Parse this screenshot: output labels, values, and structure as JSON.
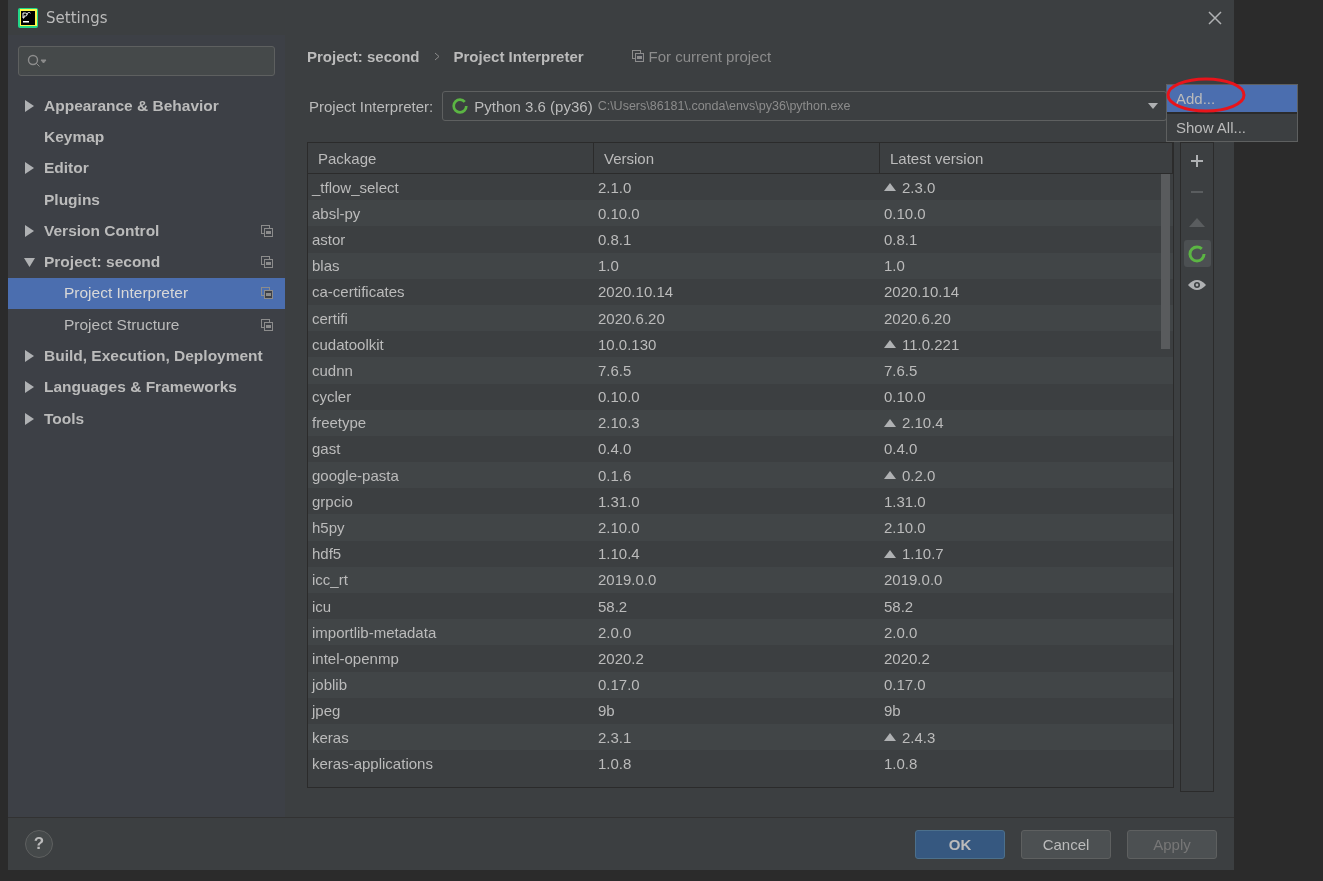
{
  "window": {
    "title": "Settings"
  },
  "sidebar": {
    "items": [
      {
        "label": "Appearance & Behavior",
        "expanded": false,
        "project_icon": false,
        "selected": false
      },
      {
        "label": "Keymap",
        "project_icon": false,
        "selected": false
      },
      {
        "label": "Editor",
        "expanded": false,
        "project_icon": false,
        "selected": false
      },
      {
        "label": "Plugins",
        "project_icon": false,
        "selected": false
      },
      {
        "label": "Version Control",
        "expanded": false,
        "project_icon": true,
        "selected": false
      },
      {
        "label": "Project: second",
        "expanded": true,
        "project_icon": true,
        "selected": false,
        "children": [
          {
            "label": "Project Interpreter",
            "project_icon": true,
            "selected": true
          },
          {
            "label": "Project Structure",
            "project_icon": true,
            "selected": false
          }
        ]
      },
      {
        "label": "Build, Execution, Deployment",
        "expanded": false,
        "project_icon": false,
        "selected": false
      },
      {
        "label": "Languages & Frameworks",
        "expanded": false,
        "project_icon": false,
        "selected": false
      },
      {
        "label": "Tools",
        "expanded": false,
        "project_icon": false,
        "selected": false
      }
    ]
  },
  "breadcrumb": [
    "Project: second",
    "Project Interpreter"
  ],
  "scope_note": "For current project",
  "interpreter": {
    "label": "Project Interpreter:",
    "name": "Python 3.6 (py36)",
    "path": "C:\\Users\\86181\\.conda\\envs\\py36\\python.exe"
  },
  "interpreter_menu": [
    {
      "label": "Add...",
      "selected": true
    },
    {
      "label": "Show All...",
      "selected": false
    }
  ],
  "table": {
    "columns": [
      "Package",
      "Version",
      "Latest version"
    ],
    "rows": [
      {
        "package": "_tflow_select",
        "version": "2.1.0",
        "latest": "2.3.0",
        "upgrade": true
      },
      {
        "package": "absl-py",
        "version": "0.10.0",
        "latest": "0.10.0",
        "upgrade": false
      },
      {
        "package": "astor",
        "version": "0.8.1",
        "latest": "0.8.1",
        "upgrade": false
      },
      {
        "package": "blas",
        "version": "1.0",
        "latest": "1.0",
        "upgrade": false
      },
      {
        "package": "ca-certificates",
        "version": "2020.10.14",
        "latest": "2020.10.14",
        "upgrade": false
      },
      {
        "package": "certifi",
        "version": "2020.6.20",
        "latest": "2020.6.20",
        "upgrade": false
      },
      {
        "package": "cudatoolkit",
        "version": "10.0.130",
        "latest": "11.0.221",
        "upgrade": true
      },
      {
        "package": "cudnn",
        "version": "7.6.5",
        "latest": "7.6.5",
        "upgrade": false
      },
      {
        "package": "cycler",
        "version": "0.10.0",
        "latest": "0.10.0",
        "upgrade": false
      },
      {
        "package": "freetype",
        "version": "2.10.3",
        "latest": "2.10.4",
        "upgrade": true
      },
      {
        "package": "gast",
        "version": "0.4.0",
        "latest": "0.4.0",
        "upgrade": false
      },
      {
        "package": "google-pasta",
        "version": "0.1.6",
        "latest": "0.2.0",
        "upgrade": true
      },
      {
        "package": "grpcio",
        "version": "1.31.0",
        "latest": "1.31.0",
        "upgrade": false
      },
      {
        "package": "h5py",
        "version": "2.10.0",
        "latest": "2.10.0",
        "upgrade": false
      },
      {
        "package": "hdf5",
        "version": "1.10.4",
        "latest": "1.10.7",
        "upgrade": true
      },
      {
        "package": "icc_rt",
        "version": "2019.0.0",
        "latest": "2019.0.0",
        "upgrade": false
      },
      {
        "package": "icu",
        "version": "58.2",
        "latest": "58.2",
        "upgrade": false
      },
      {
        "package": "importlib-metadata",
        "version": "2.0.0",
        "latest": "2.0.0",
        "upgrade": false
      },
      {
        "package": "intel-openmp",
        "version": "2020.2",
        "latest": "2020.2",
        "upgrade": false
      },
      {
        "package": "joblib",
        "version": "0.17.0",
        "latest": "0.17.0",
        "upgrade": false
      },
      {
        "package": "jpeg",
        "version": "9b",
        "latest": "9b",
        "upgrade": false
      },
      {
        "package": "keras",
        "version": "2.3.1",
        "latest": "2.4.3",
        "upgrade": true
      },
      {
        "package": "keras-applications",
        "version": "1.0.8",
        "latest": "1.0.8",
        "upgrade": false
      }
    ]
  },
  "side_tools": [
    {
      "kind": "add",
      "disabled": false,
      "selected": false
    },
    {
      "kind": "remove",
      "disabled": true,
      "selected": false
    },
    {
      "kind": "upgrade",
      "disabled": true,
      "selected": false
    },
    {
      "kind": "conda",
      "disabled": false,
      "selected": true
    },
    {
      "kind": "eye",
      "disabled": false,
      "selected": false
    }
  ],
  "buttons": [
    {
      "label": "OK",
      "kind": "default",
      "disabled": false
    },
    {
      "label": "Cancel",
      "kind": "normal",
      "disabled": false
    },
    {
      "label": "Apply",
      "kind": "normal",
      "disabled": true
    }
  ],
  "help": {
    "label": "?"
  }
}
